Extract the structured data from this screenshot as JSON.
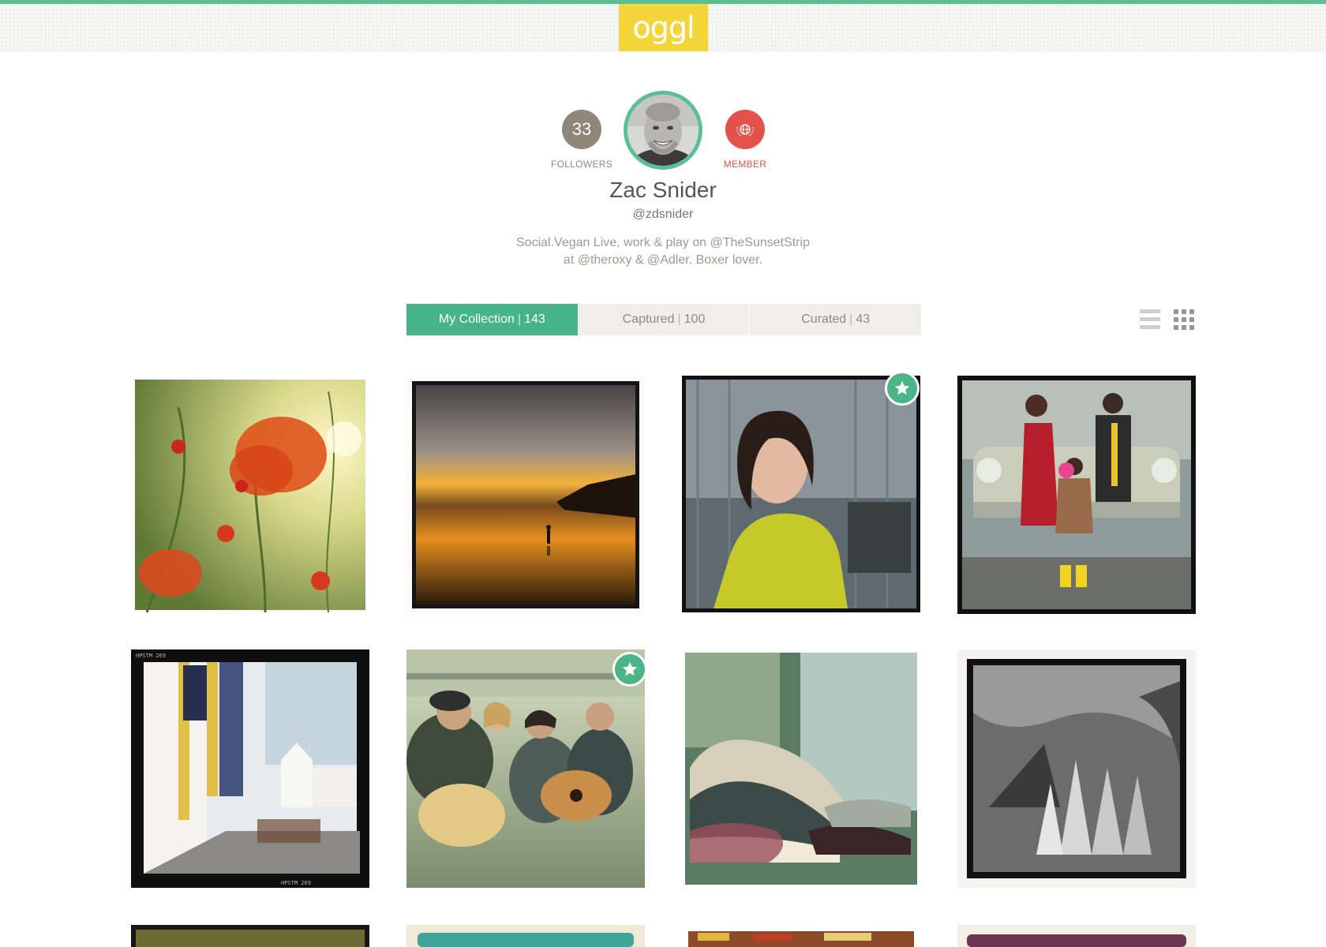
{
  "header": {
    "logo_text": "oggl",
    "accent_color": "#5bbf94",
    "logo_bg": "#f4d63a"
  },
  "profile": {
    "followers_count": "33",
    "followers_label": "FOLLOWERS",
    "member_label": "MEMBER",
    "name": "Zac Snider",
    "handle": "@zdsnider",
    "bio_line1": "Social.Vegan Live, work & play on @TheSunsetStrip",
    "bio_line2": "at @theroxy & @Adler. Boxer lover."
  },
  "tabs": [
    {
      "label": "My Collection",
      "count": "143",
      "active": true
    },
    {
      "label": "Captured",
      "count": "100",
      "active": false
    },
    {
      "label": "Curated",
      "count": "43",
      "active": false
    }
  ],
  "view_toggles": {
    "list_icon": "list-view-icon",
    "grid_icon": "grid-view-icon"
  },
  "photos": [
    {
      "subject": "poppy flowers against sunlit sky",
      "favorited": false
    },
    {
      "subject": "sunset beach with silhouette",
      "favorited": false
    },
    {
      "subject": "woman in yellow top portrait",
      "favorited": true
    },
    {
      "subject": "kids in front of vintage truck",
      "favorited": false
    },
    {
      "subject": "colonial street with white buildings",
      "favorited": false
    },
    {
      "subject": "musicians with acoustic guitars",
      "favorited": true
    },
    {
      "subject": "sneakers on shelf",
      "favorited": false
    },
    {
      "subject": "black and white architecture",
      "favorited": false
    },
    {
      "subject": "photo row 3 column 1",
      "favorited": false
    },
    {
      "subject": "photo row 3 column 2",
      "favorited": false
    },
    {
      "subject": "photo row 3 column 3",
      "favorited": false
    },
    {
      "subject": "photo row 3 column 4",
      "favorited": false
    }
  ]
}
